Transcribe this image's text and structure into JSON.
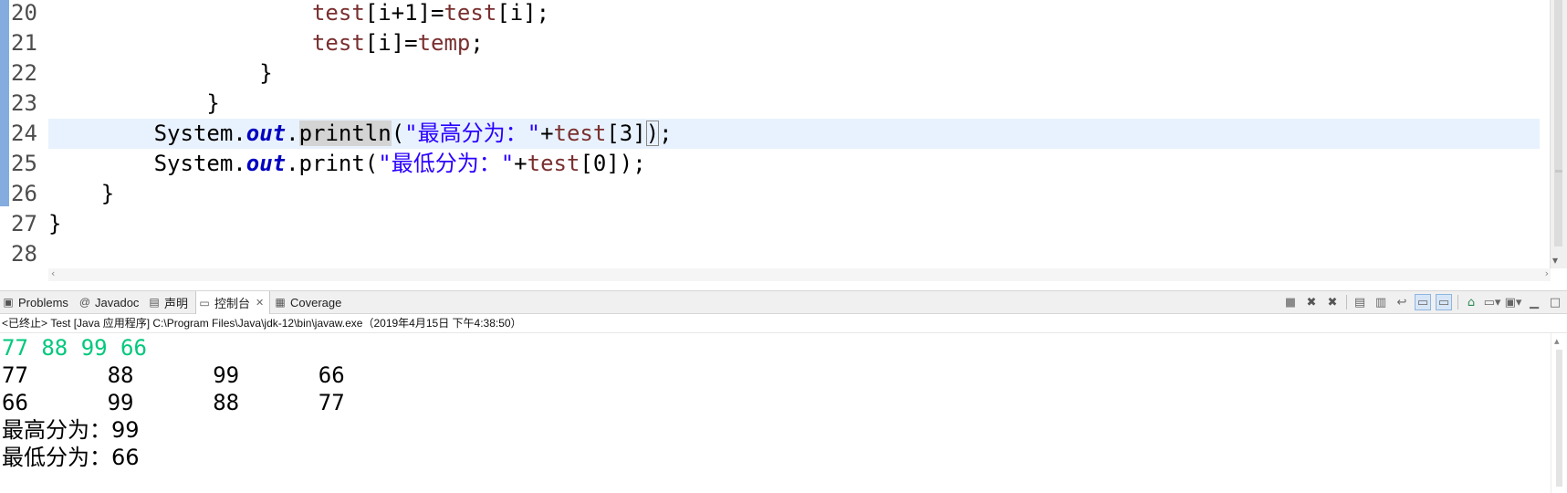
{
  "editor": {
    "line_numbers": [
      "20",
      "21",
      "22",
      "23",
      "24",
      "25",
      "26",
      "27",
      "28"
    ],
    "lines": [
      {
        "indent": "                    ",
        "parts": [
          {
            "t": "test",
            "c": "field"
          },
          {
            "t": "[i+1]=",
            "c": ""
          },
          {
            "t": "test",
            "c": "field"
          },
          {
            "t": "[i];",
            "c": ""
          }
        ]
      },
      {
        "indent": "                    ",
        "parts": [
          {
            "t": "test",
            "c": "field"
          },
          {
            "t": "[i]=",
            "c": ""
          },
          {
            "t": "temp",
            "c": "field"
          },
          {
            "t": ";",
            "c": ""
          }
        ]
      },
      {
        "indent": "                ",
        "parts": [
          {
            "t": "}",
            "c": ""
          }
        ]
      },
      {
        "indent": "            ",
        "parts": [
          {
            "t": "}",
            "c": ""
          }
        ]
      },
      {
        "indent": "        ",
        "current": true,
        "parts": [
          {
            "t": "System.",
            "c": ""
          },
          {
            "t": "out",
            "c": "static"
          },
          {
            "t": ".",
            "c": ""
          },
          {
            "t": "println",
            "c": "hl"
          },
          {
            "t": "(",
            "c": ""
          },
          {
            "t": "\"最高分为：\"",
            "c": "string"
          },
          {
            "t": "+",
            "c": ""
          },
          {
            "t": "test",
            "c": "field"
          },
          {
            "t": "[3]",
            "c": ""
          },
          {
            "t": ")",
            "c": "bracket"
          },
          {
            "t": ";",
            "c": ""
          }
        ]
      },
      {
        "indent": "        ",
        "parts": [
          {
            "t": "System.",
            "c": ""
          },
          {
            "t": "out",
            "c": "static"
          },
          {
            "t": ".print(",
            "c": ""
          },
          {
            "t": "\"最低分为：\"",
            "c": "string"
          },
          {
            "t": "+",
            "c": ""
          },
          {
            "t": "test",
            "c": "field"
          },
          {
            "t": "[0]);",
            "c": ""
          }
        ]
      },
      {
        "indent": "    ",
        "parts": [
          {
            "t": "}",
            "c": ""
          }
        ]
      },
      {
        "indent": "",
        "parts": [
          {
            "t": "}",
            "c": ""
          }
        ]
      },
      {
        "indent": "",
        "parts": []
      }
    ]
  },
  "views": {
    "tabs": [
      {
        "label": "Problems",
        "icon": "problems-icon",
        "glyph": "▣"
      },
      {
        "label": "Javadoc",
        "icon": "javadoc-icon",
        "glyph": "@"
      },
      {
        "label": "声明",
        "icon": "declaration-icon",
        "glyph": "▤"
      },
      {
        "label": "控制台",
        "icon": "console-icon",
        "glyph": "▭",
        "active": true
      },
      {
        "label": "Coverage",
        "icon": "coverage-icon",
        "glyph": "▦"
      }
    ],
    "toolbar_icons": [
      "terminate-icon",
      "remove-launch-icon",
      "remove-all-terminated-icon",
      "clear-console-icon",
      "scroll-lock-icon",
      "word-wrap-icon",
      "show-on-stdout-icon",
      "show-on-stderr-icon",
      "pin-console-icon",
      "display-console-icon",
      "open-console-icon",
      "minimize-icon",
      "maximize-icon"
    ]
  },
  "console": {
    "header": "<已终止> Test [Java 应用程序] C:\\Program Files\\Java\\jdk-12\\bin\\javaw.exe（2019年4月15日 下午4:38:50）",
    "input_line": "77 88 99 66",
    "output_lines": [
      "77      88      99      66",
      "66      99      88      77",
      "最高分为：99",
      "最低分为：66"
    ],
    "input_color": "#00c87c"
  }
}
